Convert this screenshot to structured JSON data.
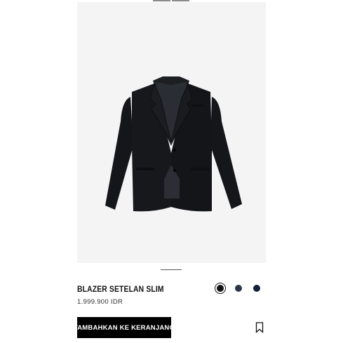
{
  "carousel": {
    "top_indicator_count": 2,
    "pager_count": 1
  },
  "product": {
    "image_icon": "blazer-photo",
    "name": "BLAZER SETELAN SLIM",
    "price": "1.999.900 IDR"
  },
  "colors": [
    {
      "name": "black",
      "hex": "#111111",
      "selected": true
    },
    {
      "name": "charcoal-navy",
      "hex": "#2e3646",
      "selected": false
    },
    {
      "name": "navy",
      "hex": "#13203b",
      "selected": false
    }
  ],
  "actions": {
    "add_to_cart_label": "TAMBAHKAN KE KERANJANG",
    "bookmark_icon": "bookmark-icon"
  },
  "theme": {
    "background": "#ffffff",
    "image_background": "#f4f4f4",
    "button_background": "#000000",
    "button_text": "#ffffff"
  }
}
